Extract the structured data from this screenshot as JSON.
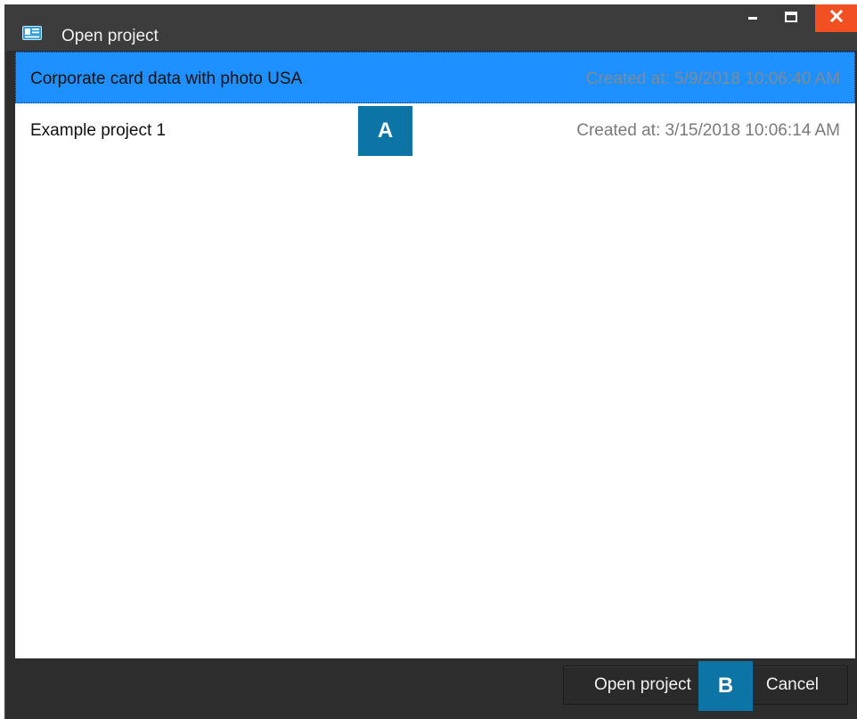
{
  "window": {
    "title": "Open project",
    "controls": {
      "minimize": "minimize-icon",
      "maximize": "maximize-icon",
      "close": "close-icon"
    }
  },
  "projects": [
    {
      "name": "Corporate card data with photo USA",
      "created": "Created at: 5/9/2018 10:06:40 AM",
      "selected": true
    },
    {
      "name": "Example project 1",
      "created": "Created at: 3/15/2018 10:06:14 AM",
      "selected": false
    }
  ],
  "footer": {
    "open_label": "Open project",
    "cancel_label": "Cancel"
  },
  "callouts": {
    "a": "A",
    "b": "B"
  },
  "colors": {
    "selection": "#1e90ff",
    "close_button": "#f25022",
    "callout": "#0d74a6",
    "titlebar": "#3c3c3c"
  }
}
